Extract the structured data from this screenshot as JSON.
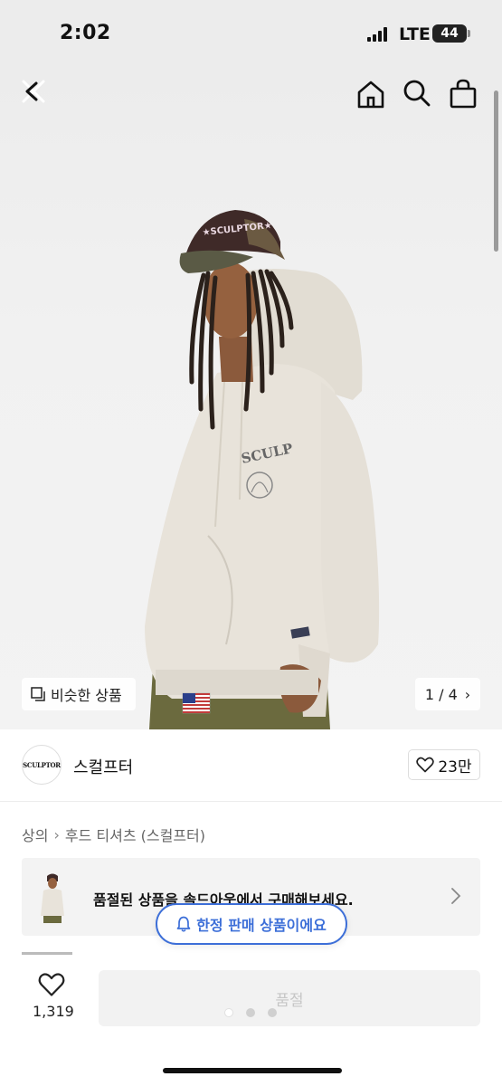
{
  "status_bar": {
    "time": "2:02",
    "carrier": "LTE",
    "battery": "44"
  },
  "nav": {
    "icons": [
      "close-icon",
      "home-icon",
      "search-icon",
      "shopping-bag-icon"
    ]
  },
  "gallery": {
    "similar_label": "비슷한 상품",
    "page_counter": "1 / 4",
    "patch_text": "SCULPTOR"
  },
  "brand": {
    "logo_text": "SCULPTOR",
    "name": "스컬프터",
    "likes": "23만"
  },
  "breadcrumb": {
    "items": [
      "상의",
      "후드 티셔츠 (스컬프터)"
    ]
  },
  "soldout_banner": {
    "text": "품절된 상품을 솔드아웃에서 구매해보세요."
  },
  "limited_pill": {
    "text": "한정 판매 상품이에요"
  },
  "bottom": {
    "wish_count": "1,319",
    "buy_label": "품절"
  },
  "colors": {
    "accent": "#3d6fd8",
    "sweatshirt": "#e8e3da",
    "pants": "#6b6a3e",
    "cap": "#3f2a28"
  }
}
